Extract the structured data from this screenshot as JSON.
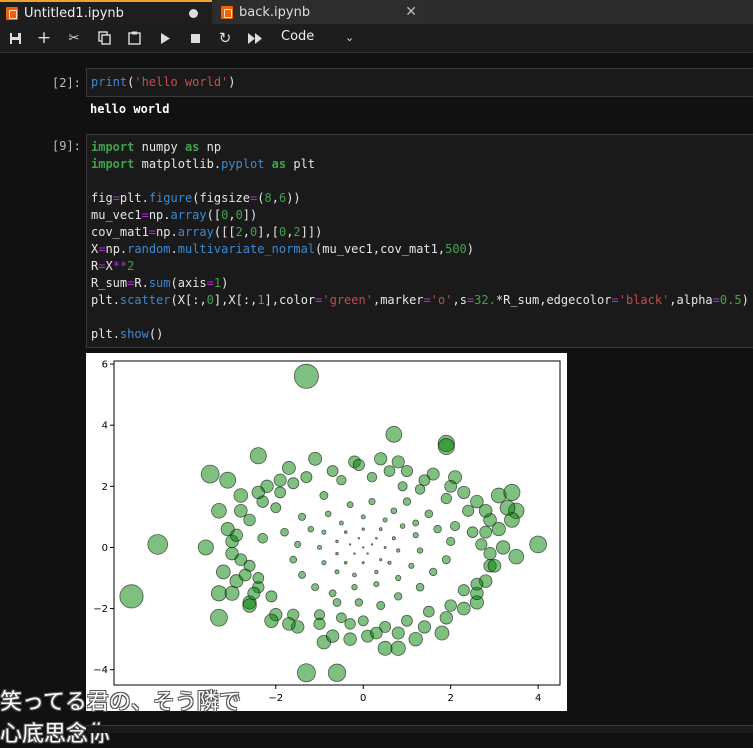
{
  "tabs": [
    {
      "label": "Untitled1.ipynb",
      "status": "unsaved"
    },
    {
      "label": "back.ipynb",
      "status": "closeable"
    }
  ],
  "toolbar": {
    "buttons": [
      "save-icon",
      "add-cell-icon",
      "cut-icon",
      "copy-icon",
      "paste-icon",
      "run-icon",
      "stop-icon",
      "restart-icon",
      "run-all-icon"
    ],
    "cell_type": "Code"
  },
  "cells": [
    {
      "prompt": "[2]:",
      "source": [
        "print('hello world')"
      ],
      "output": "hello world"
    },
    {
      "prompt": "[9]:",
      "source": [
        "import numpy as np",
        "import matplotlib.pyplot as plt",
        "",
        "fig=plt.figure(figsize=(8,6))",
        "mu_vec1=np.array([0,0])",
        "cov_mat1=np.array([[2,0],[0,2]])",
        "X=np.random.multivariate_normal(mu_vec1,cov_mat1,500)",
        "R=X**2",
        "R_sum=R.sum(axis=1)",
        "plt.scatter(X[:,0],X[:,1],color='green',marker='o',s=32.*R_sum,edgecolor='black',alpha=0.5)",
        "",
        "plt.show()"
      ]
    }
  ],
  "subtitles": [
    "笑ってる君の、そう隣で",
    "心底思念你"
  ],
  "chart_data": {
    "type": "scatter",
    "title": "",
    "xlabel": "",
    "ylabel": "",
    "xlim": [
      -5.7,
      4.5
    ],
    "ylim": [
      -4.5,
      6.1
    ],
    "xticks": [
      -2,
      0,
      2,
      4
    ],
    "yticks": [
      -4,
      -2,
      0,
      2,
      4,
      6
    ],
    "color": "#008000",
    "edgecolor": "#000000",
    "alpha": 0.5,
    "marker_size_rule": "s = 32 * (x^2 + y^2)",
    "points": [
      [
        -1.3,
        5.6
      ],
      [
        -5.3,
        -1.6
      ],
      [
        -4.7,
        0.1
      ],
      [
        -3.3,
        1.2
      ],
      [
        -2.4,
        3.0
      ],
      [
        0.7,
        3.7
      ],
      [
        1.9,
        3.4
      ],
      [
        1.9,
        3.3
      ],
      [
        -3.5,
        2.4
      ],
      [
        -3.1,
        2.2
      ],
      [
        3.1,
        1.7
      ],
      [
        3.4,
        1.8
      ],
      [
        3.5,
        1.2
      ],
      [
        3.4,
        0.9
      ],
      [
        4.0,
        0.1
      ],
      [
        3.5,
        -0.3
      ],
      [
        -3.6,
        0.0
      ],
      [
        -3.0,
        0.2
      ],
      [
        -3.2,
        -0.8
      ],
      [
        -3.3,
        -1.5
      ],
      [
        -2.6,
        -1.8
      ],
      [
        -2.6,
        -1.9
      ],
      [
        -3.3,
        -2.3
      ],
      [
        -1.3,
        -4.1
      ],
      [
        -0.6,
        -4.1
      ],
      [
        -0.9,
        -3.1
      ],
      [
        -0.3,
        -2.5
      ],
      [
        0.1,
        -2.9
      ],
      [
        0.5,
        -3.3
      ],
      [
        0.8,
        -3.3
      ],
      [
        1.2,
        -3.0
      ],
      [
        1.8,
        -2.8
      ],
      [
        2.6,
        -1.8
      ],
      [
        2.6,
        -1.5
      ],
      [
        2.9,
        -0.6
      ],
      [
        2.7,
        0.1
      ],
      [
        2.5,
        0.5
      ],
      [
        2.1,
        0.7
      ],
      [
        -0.9,
        1.7
      ],
      [
        -1.6,
        2.1
      ],
      [
        -2.0,
        1.3
      ],
      [
        -0.2,
        2.8
      ],
      [
        0.4,
        2.9
      ],
      [
        0.9,
        2.0
      ],
      [
        1.3,
        1.9
      ],
      [
        2.1,
        2.3
      ],
      [
        2.6,
        1.5
      ],
      [
        2.9,
        0.9
      ],
      [
        1.9,
        1.6
      ],
      [
        1.5,
        1.1
      ],
      [
        1.0,
        1.5
      ],
      [
        -1.4,
        1.0
      ],
      [
        -1.8,
        0.5
      ],
      [
        -2.3,
        0.3
      ],
      [
        -2.6,
        -0.6
      ],
      [
        -2.4,
        -1.3
      ],
      [
        -2.0,
        -2.2
      ],
      [
        -1.5,
        -2.6
      ],
      [
        -1.0,
        -2.2
      ],
      [
        -0.6,
        -1.8
      ],
      [
        -0.1,
        -1.8
      ],
      [
        0.4,
        -1.9
      ],
      [
        0.8,
        -1.6
      ],
      [
        1.3,
        -1.3
      ],
      [
        1.6,
        -0.8
      ],
      [
        1.9,
        -0.4
      ],
      [
        2.0,
        0.2
      ],
      [
        1.7,
        0.6
      ],
      [
        1.2,
        0.8
      ],
      [
        0.7,
        1.2
      ],
      [
        0.2,
        1.5
      ],
      [
        -0.3,
        1.4
      ],
      [
        -0.8,
        1.1
      ],
      [
        -1.2,
        0.6
      ],
      [
        -1.5,
        0.1
      ],
      [
        -1.6,
        -0.4
      ],
      [
        -1.4,
        -0.9
      ],
      [
        -1.1,
        -1.3
      ],
      [
        -0.7,
        -1.5
      ],
      [
        -0.2,
        -1.3
      ],
      [
        0.3,
        -1.2
      ],
      [
        0.8,
        -1.0
      ],
      [
        1.1,
        -0.6
      ],
      [
        1.3,
        -0.1
      ],
      [
        1.2,
        0.4
      ],
      [
        0.9,
        0.7
      ],
      [
        0.5,
        0.9
      ],
      [
        0.0,
        1.0
      ],
      [
        -0.5,
        0.8
      ],
      [
        -0.9,
        0.5
      ],
      [
        -1.0,
        0.0
      ],
      [
        -0.9,
        -0.5
      ],
      [
        -0.6,
        -0.8
      ],
      [
        -0.2,
        -0.9
      ],
      [
        0.3,
        -0.8
      ],
      [
        0.6,
        -0.5
      ],
      [
        0.8,
        -0.1
      ],
      [
        0.7,
        0.3
      ],
      [
        0.4,
        0.6
      ],
      [
        0.0,
        0.6
      ],
      [
        -0.4,
        0.5
      ],
      [
        -0.6,
        0.2
      ],
      [
        -0.6,
        -0.2
      ],
      [
        -0.4,
        -0.5
      ],
      [
        0.0,
        -0.5
      ],
      [
        0.4,
        -0.4
      ],
      [
        0.5,
        0.0
      ],
      [
        0.3,
        0.3
      ],
      [
        -0.1,
        0.3
      ],
      [
        -0.3,
        0.1
      ],
      [
        -0.2,
        -0.2
      ],
      [
        0.1,
        -0.2
      ],
      [
        0.2,
        0.1
      ],
      [
        0.0,
        0.0
      ],
      [
        -2.8,
        1.7
      ],
      [
        -2.2,
        2.0
      ],
      [
        -1.7,
        2.6
      ],
      [
        -1.1,
        2.9
      ],
      [
        -0.5,
        2.2
      ],
      [
        0.2,
        2.3
      ],
      [
        0.6,
        2.5
      ],
      [
        1.0,
        2.5
      ],
      [
        1.6,
        2.4
      ],
      [
        2.0,
        2.0
      ],
      [
        2.3,
        1.8
      ],
      [
        2.8,
        1.2
      ],
      [
        3.1,
        0.6
      ],
      [
        3.2,
        0.0
      ],
      [
        3.0,
        -0.6
      ],
      [
        2.8,
        -1.1
      ],
      [
        2.3,
        -1.4
      ],
      [
        2.0,
        -1.9
      ],
      [
        1.5,
        -2.1
      ],
      [
        1.0,
        -2.4
      ],
      [
        0.5,
        -2.6
      ],
      [
        0.0,
        -2.4
      ],
      [
        -0.5,
        -2.3
      ],
      [
        -1.0,
        -2.5
      ],
      [
        -1.6,
        -2.2
      ],
      [
        -2.1,
        -1.6
      ],
      [
        -2.4,
        -1.0
      ],
      [
        -2.8,
        -0.4
      ],
      [
        -2.9,
        0.4
      ],
      [
        -2.6,
        0.9
      ],
      [
        -2.3,
        1.5
      ],
      [
        -1.9,
        1.8
      ],
      [
        -2.9,
        -1.1
      ],
      [
        -3.0,
        -1.5
      ],
      [
        -2.1,
        -2.4
      ],
      [
        -1.7,
        -2.5
      ],
      [
        -0.7,
        -2.9
      ],
      [
        -0.3,
        -3.0
      ],
      [
        0.3,
        -2.8
      ],
      [
        0.8,
        -2.8
      ],
      [
        1.4,
        -2.6
      ],
      [
        1.9,
        -2.3
      ],
      [
        2.3,
        -2.0
      ],
      [
        2.6,
        -1.2
      ],
      [
        2.9,
        -0.2
      ],
      [
        2.8,
        0.5
      ],
      [
        3.3,
        1.3
      ],
      [
        2.4,
        1.2
      ],
      [
        1.4,
        2.2
      ],
      [
        0.8,
        2.8
      ],
      [
        -0.1,
        2.7
      ],
      [
        -0.7,
        2.5
      ],
      [
        -1.3,
        2.3
      ],
      [
        -1.9,
        2.2
      ],
      [
        -2.4,
        1.8
      ],
      [
        -2.8,
        1.2
      ],
      [
        -3.1,
        0.6
      ],
      [
        -3.0,
        -0.2
      ],
      [
        -2.7,
        -0.9
      ],
      [
        -2.5,
        -1.5
      ]
    ]
  }
}
